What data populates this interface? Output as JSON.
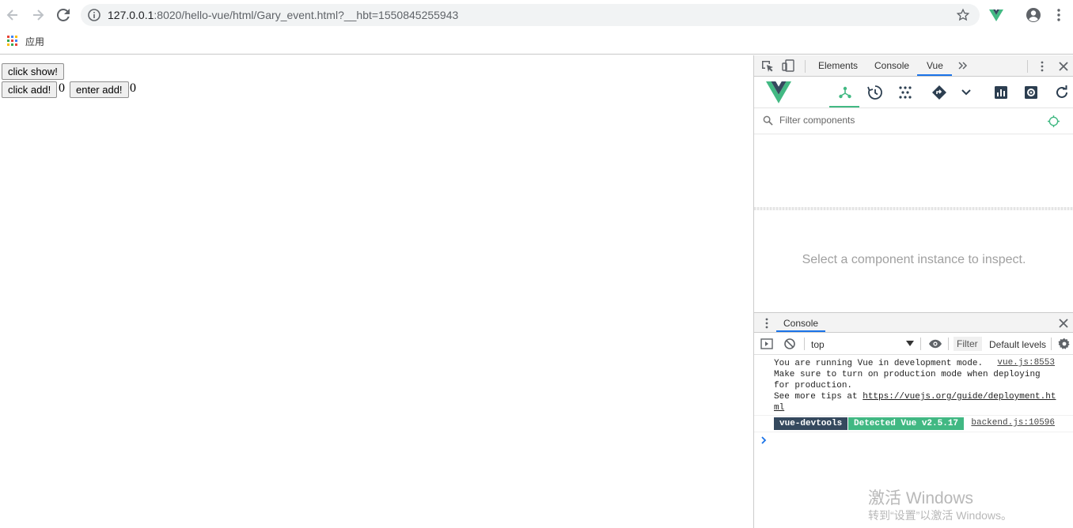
{
  "browser": {
    "url_host": "127.0.0.1",
    "url_rest": ":8020/hello-vue/html/Gary_event.html?__hbt=1550845255943",
    "bookmark_apps": "应用"
  },
  "page": {
    "show_button": "click show!",
    "add_button": "click add!",
    "add_count": "0",
    "enter_button": "enter add!",
    "enter_count": "0"
  },
  "devtools": {
    "tabs": [
      "Elements",
      "Console",
      "Vue"
    ],
    "active_tab": "Vue",
    "filter_placeholder": "Filter components",
    "inspect_hint": "Select a component instance to inspect.",
    "accent_color": "#42b983"
  },
  "console": {
    "drawer_tab": "Console",
    "context": "top",
    "filter_label": "Filter",
    "level": "Default levels",
    "messages": [
      "You are running Vue in development mode.",
      "Make sure to turn on production mode when deploying",
      "for production.",
      "See more tips at ",
      "ml"
    ],
    "link_text": "https://vuejs.org/guide/deployment.ht",
    "source1": "vue.js:8553",
    "badge_devtools": "vue-devtools",
    "badge_detected": "Detected Vue v2.5.17",
    "source2": "backend.js:10596"
  },
  "watermark": {
    "line1": "激活 Windows",
    "line2": "转到“设置”以激活 Windows。"
  }
}
